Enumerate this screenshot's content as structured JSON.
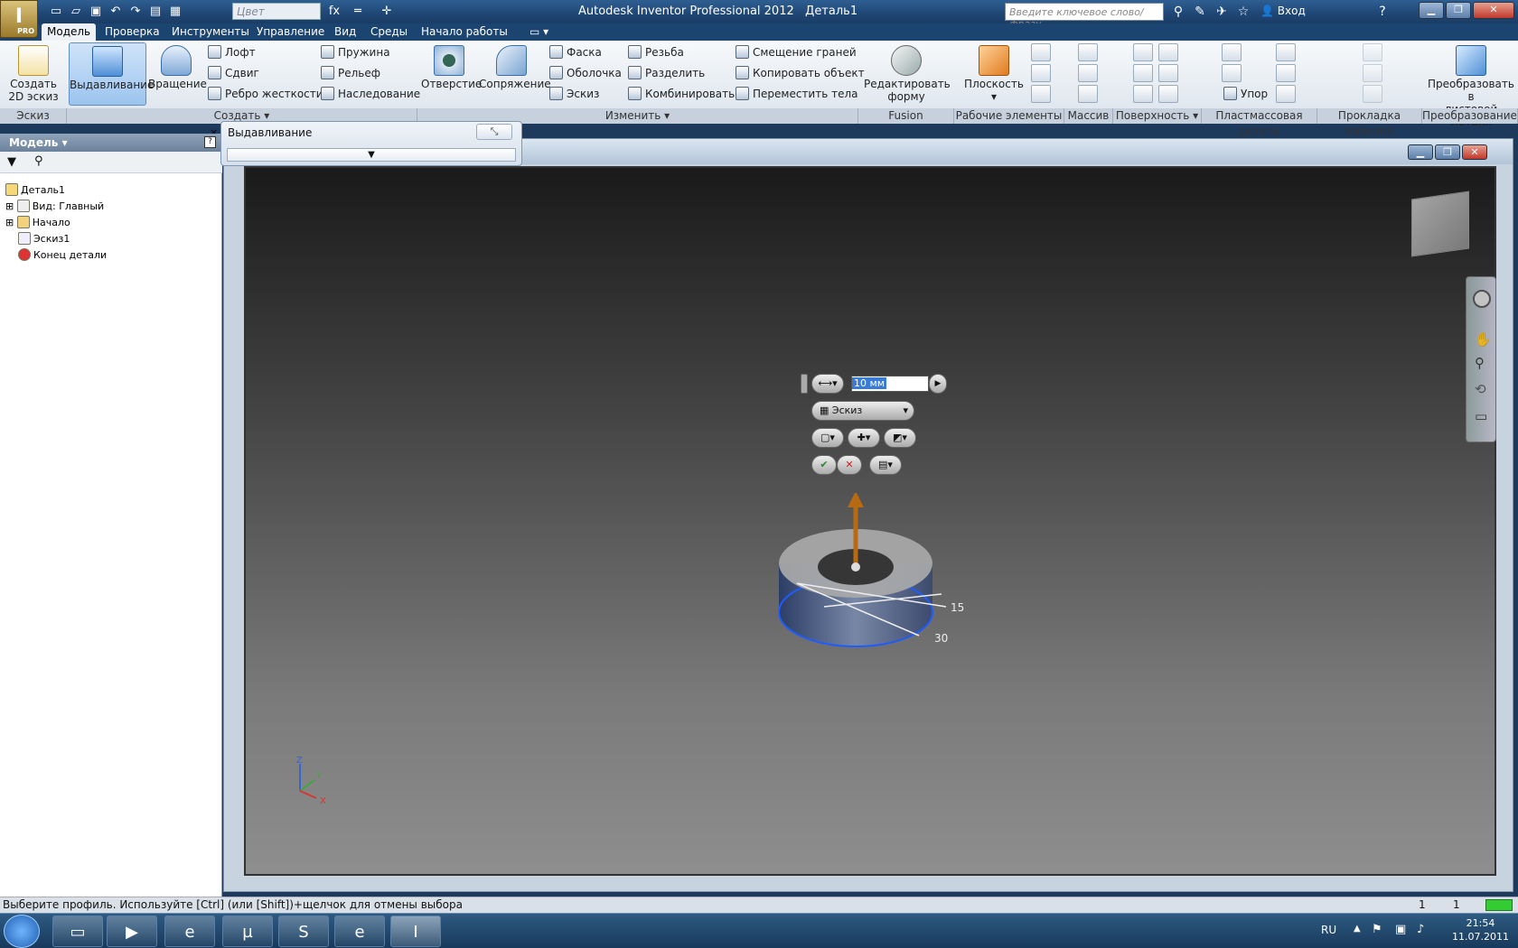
{
  "app": {
    "title": "Autodesk Inventor Professional 2012",
    "document": "Деталь1",
    "pro_badge": "PRO"
  },
  "qat": {
    "color_placeholder": "Цвет",
    "fx": "fx"
  },
  "search": {
    "placeholder": "Введите ключевое слово/фразу"
  },
  "login": "Вход",
  "tabs": [
    "Модель",
    "Проверка",
    "Инструменты",
    "Управление",
    "Вид",
    "Среды",
    "Начало работы"
  ],
  "ribbon": {
    "sketch": {
      "btn": [
        "Создать",
        "2D эскиз"
      ],
      "panel": "Эскиз"
    },
    "create": {
      "panel": "Создать",
      "extrude": "Выдавливание",
      "revolve": "Вращение",
      "loft": "Лофт",
      "sweep": "Сдвиг",
      "rib": "Ребро жесткости",
      "coil": "Пружина",
      "emboss": "Рельеф",
      "derive": "Наследование"
    },
    "modify": {
      "panel": "Изменить",
      "hole": "Отверстие",
      "fillet": "Сопряжение",
      "chamfer": "Фаска",
      "shell": "Оболочка",
      "draft": "Эскиз",
      "thread": "Резьба",
      "split": "Разделить",
      "combine": "Комбинировать",
      "move_face": "Смещение граней",
      "copy_obj": "Копировать объект",
      "move_bodies": "Переместить тела"
    },
    "fusion": {
      "btn": [
        "Редактировать",
        "форму"
      ],
      "panel": "Fusion"
    },
    "work": {
      "plane": "Плоскость",
      "panel": "Рабочие элементы"
    },
    "pattern": {
      "panel": "Массив"
    },
    "surface": {
      "panel": "Поверхность"
    },
    "plastic": {
      "rest": "Упор",
      "panel": "Пластмассовая деталь"
    },
    "cable": {
      "panel": "Прокладка кабелей"
    },
    "convert": {
      "btn": [
        "Преобразовать в",
        "листовой металл"
      ],
      "panel": "Преобразование"
    }
  },
  "browser": {
    "header": "Модель",
    "help": "?",
    "tree": [
      "Деталь1",
      "Вид: Главный",
      "Начало",
      "Эскиз1",
      "Конец детали"
    ]
  },
  "extrude_dialog": {
    "title": "Выдавливание"
  },
  "minitoolbar": {
    "distance": "10 мм",
    "profile": "Эскиз"
  },
  "dimensions": [
    "15",
    "30"
  ],
  "triad": [
    "Z",
    "Y",
    "X"
  ],
  "status": {
    "message": "Выберите профиль. Используйте [Ctrl] (или [Shift])+щелчок для отмены выбора",
    "count1": "1",
    "count2": "1"
  },
  "taskbar": {
    "lang": "RU",
    "time": "21:54",
    "date": "11.07.2011"
  }
}
